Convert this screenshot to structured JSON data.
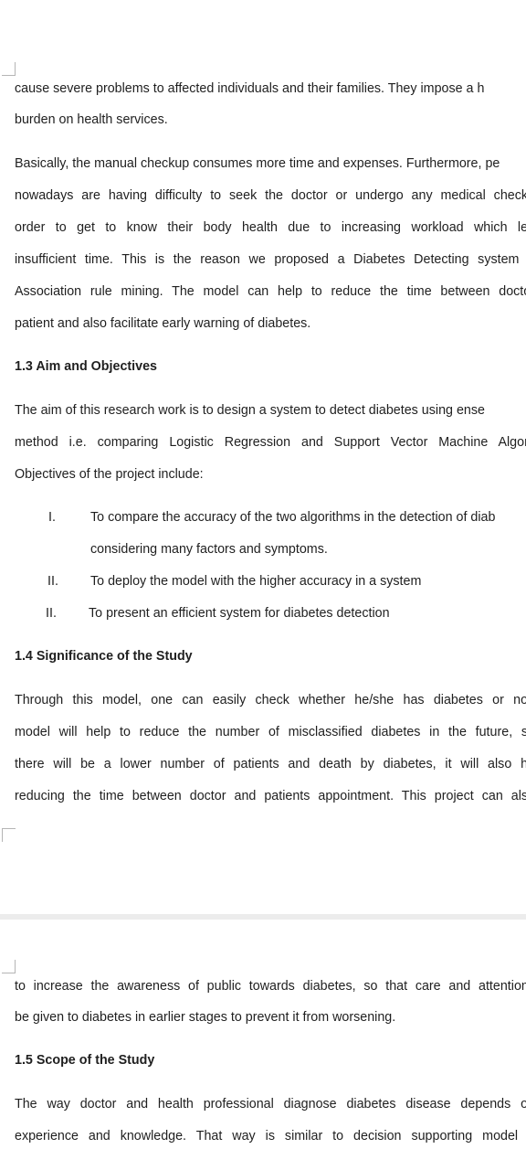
{
  "page1": {
    "lines_intro": [
      "cause severe problems to affected individuals and their families. They impose a h",
      "burden on health services."
    ],
    "paragraph2": [
      "Basically, the manual checkup consumes more time and expenses. Furthermore, pe",
      "nowadays are having difficulty to seek the doctor or undergo any medical checku",
      "order to get to know their body health due to increasing workload which lea",
      "insufficient time. This is the reason we proposed a Diabetes Detecting system u",
      "Association rule mining. The model can help to reduce the time between doctor",
      "patient and also facilitate early warning of diabetes."
    ],
    "heading_aim": "1.3 Aim and Objectives",
    "aim_paragraph": [
      "The aim of this research work is to design a system to detect diabetes using ense",
      "method i.e. comparing Logistic Regression and Support Vector Machine Algorit",
      "Objectives of the project include:"
    ],
    "objectives": [
      {
        "num": "I.",
        "lines": [
          "To compare the accuracy of the two algorithms in the detection of diab",
          "considering many factors and symptoms."
        ]
      },
      {
        "num": "II.",
        "lines": [
          "To deploy the model with the higher accuracy in a system"
        ]
      },
      {
        "num": "II.",
        "lines": [
          "To present an efficient system for diabetes detection"
        ]
      }
    ],
    "heading_significance": "1.4 Significance of the Study",
    "significance_paragraph": [
      "Through this model, one can easily check whether he/she has diabetes or not.",
      "model will help to reduce the number of misclassified diabetes in the future, so",
      "there will be a lower number of patients and death by diabetes, it will also he",
      "reducing the time between doctor and patients appointment. This project can also"
    ]
  },
  "page2": {
    "continuation": [
      "to increase the awareness of public towards diabetes, so that care and attentions",
      "be given to diabetes in earlier stages to prevent it from worsening."
    ],
    "heading_scope": "1.5 Scope of the Study",
    "scope_paragraph": [
      "The way doctor and health professional diagnose diabetes disease depends on",
      "experience and knowledge. That way is similar to decision supporting model u"
    ]
  }
}
